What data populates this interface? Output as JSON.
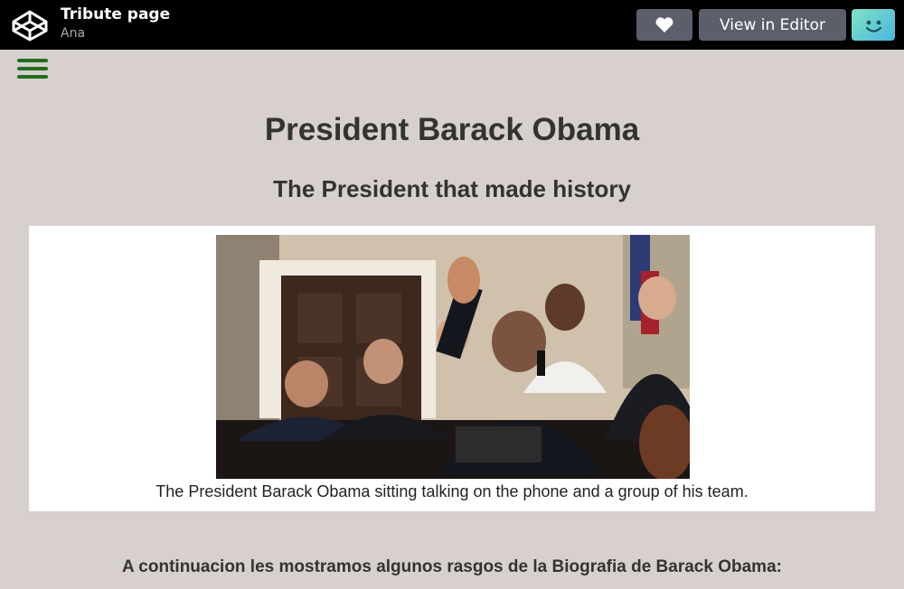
{
  "header": {
    "title": "Tribute page",
    "author": "Ana",
    "editor_button": "View in Editor",
    "icons": {
      "logo": "codepen-logo-icon",
      "like": "heart-icon",
      "avatar": "user-avatar-icon",
      "menu": "hamburger-menu-icon"
    }
  },
  "main": {
    "title": "President Barack Obama",
    "subtitle": "The President that made history",
    "caption": "The President Barack Obama sitting talking on the phone and a group of his team.",
    "bio_heading": "A continuacion les mostramos algunos rasgos de la Biografia de Barack Obama:"
  },
  "colors": {
    "page_background": "#d8d0cc",
    "top_bar": "#000000",
    "button": "#5a5f6a",
    "menu_accent": "#1f6e1f"
  }
}
